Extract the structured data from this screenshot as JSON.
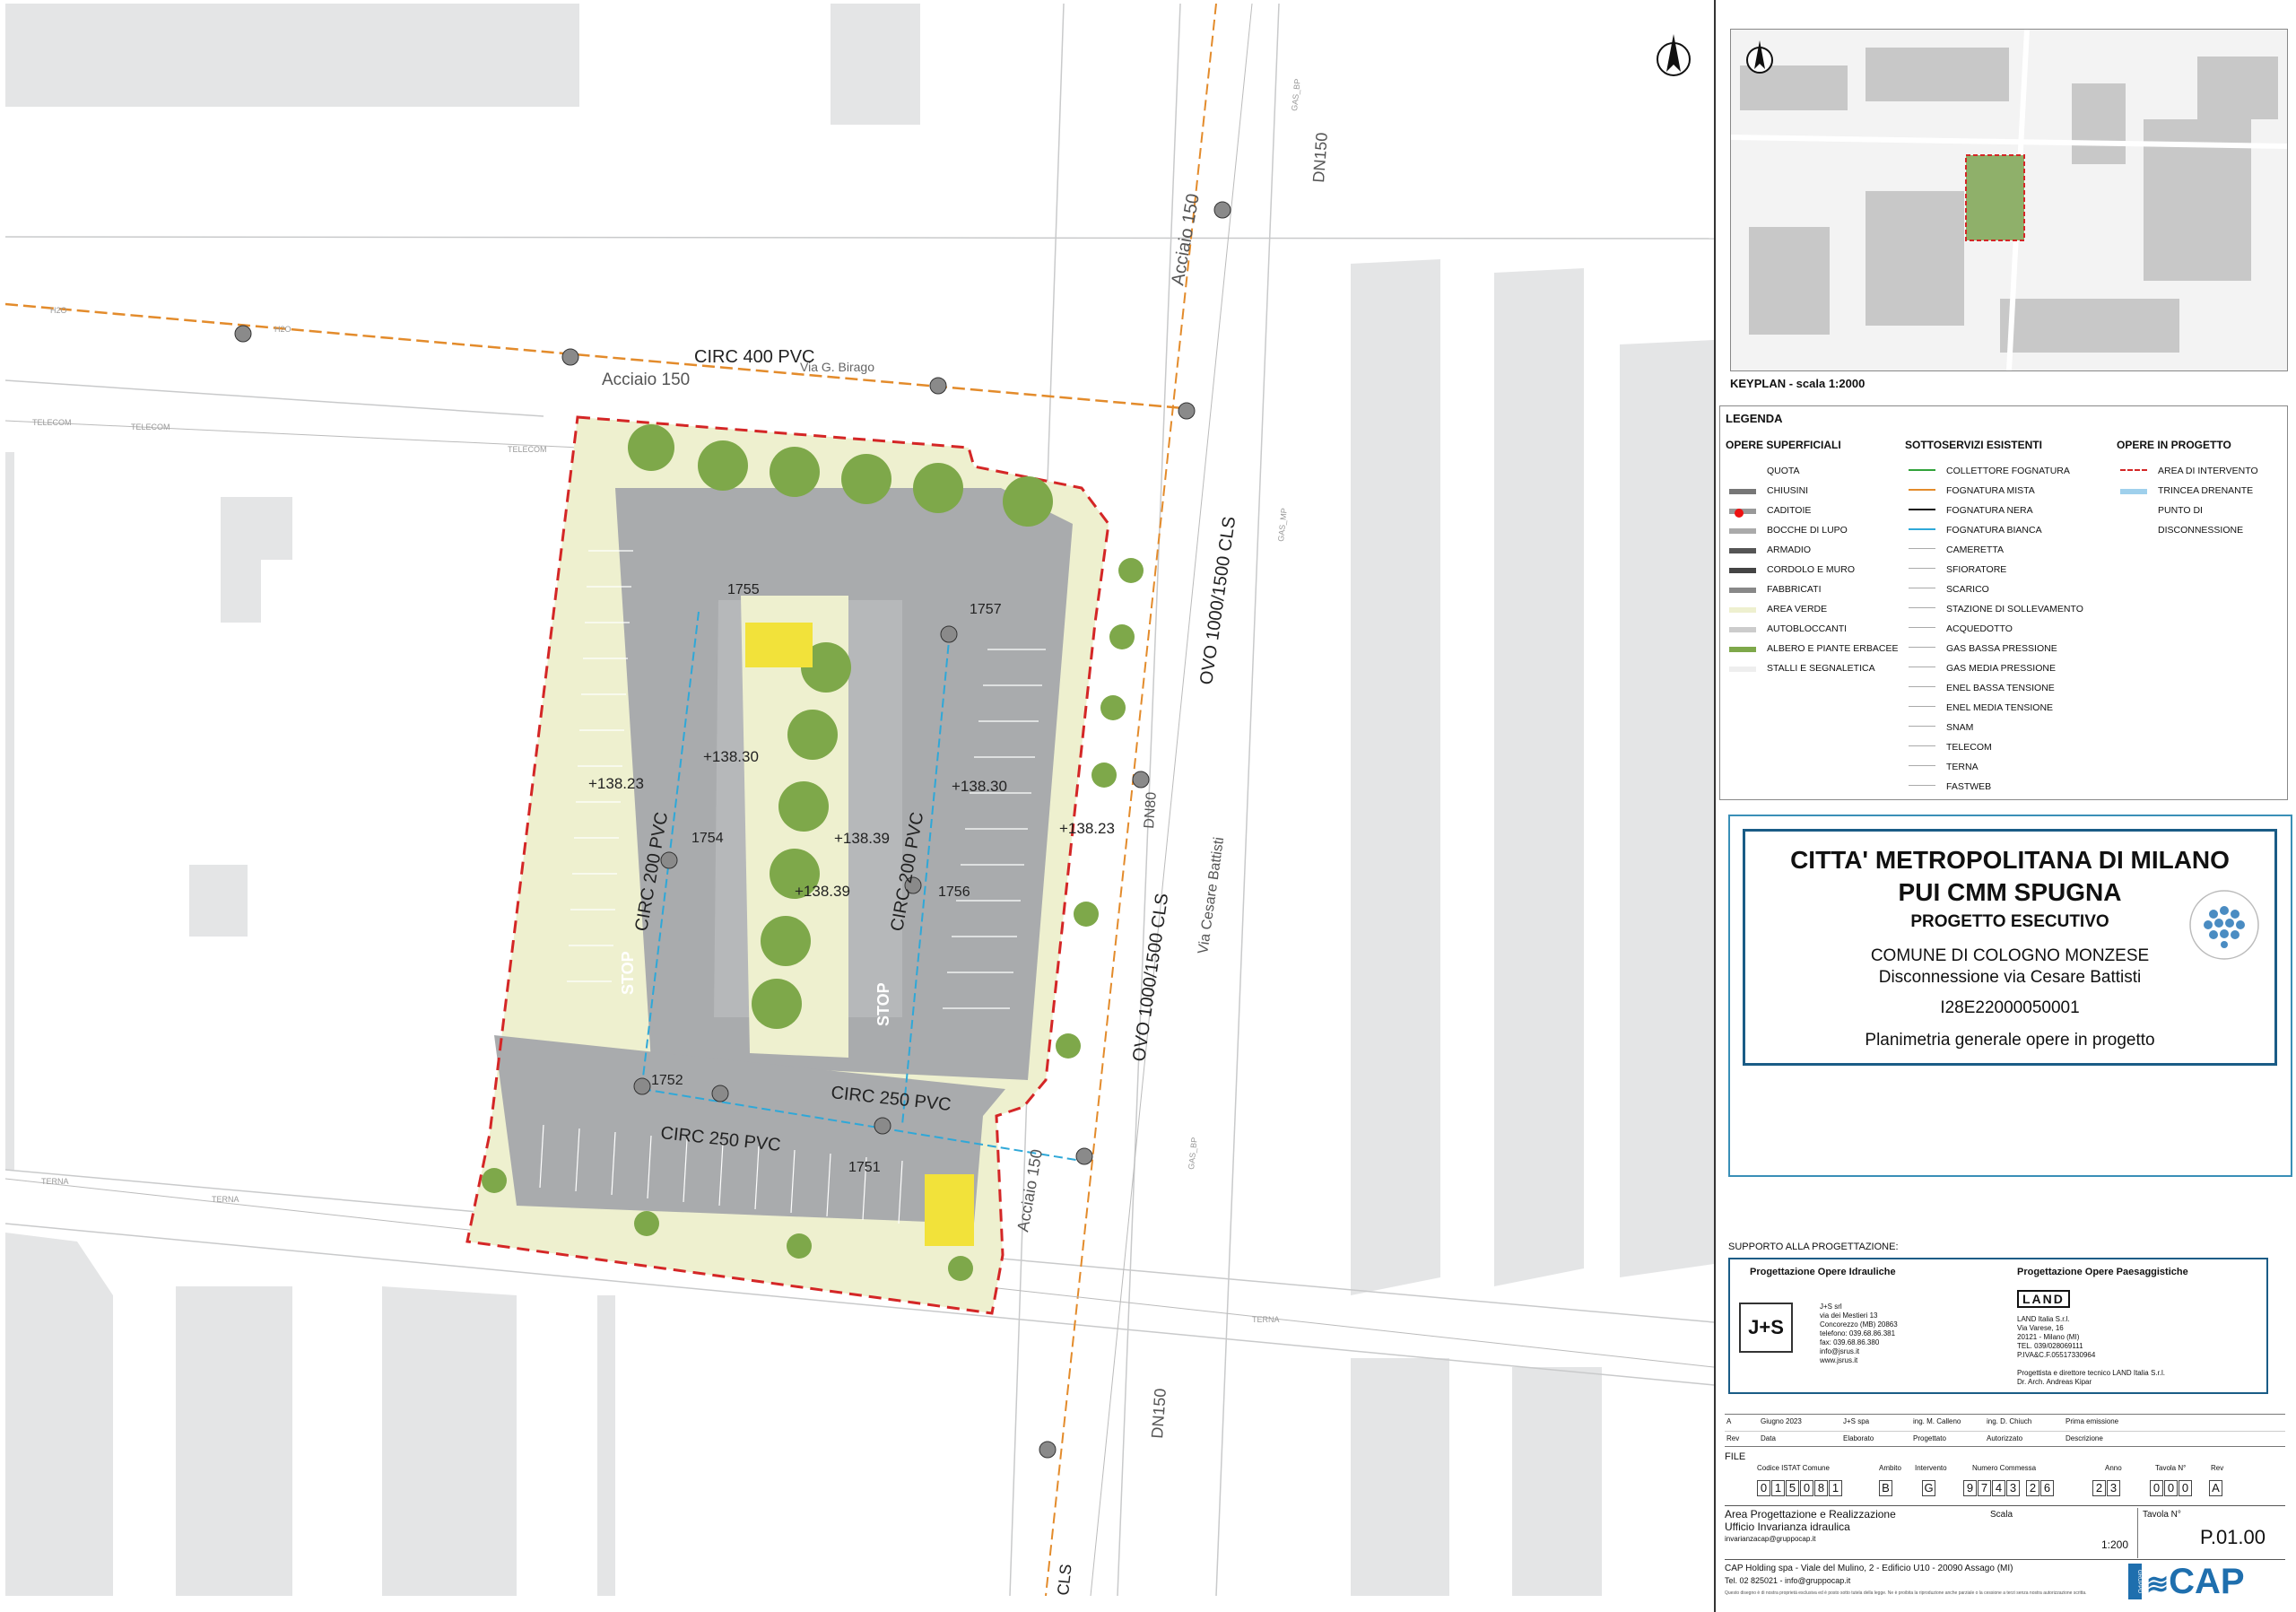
{
  "map": {
    "road_labels": {
      "circ400": "CIRC 400 PVC",
      "acciaio150_top": "Acciaio 150",
      "acciaio150_right": "Acciaio 150",
      "acciaio150_bottom": "Acciaio 150",
      "via_birago": "Via G. Birago",
      "via_battisti": "Via Cesare Battisti",
      "ovo_top": "OVO 1000/1500 CLS",
      "ovo_mid": "OVO 1000/1500 CLS",
      "cls_bottom": "CLS",
      "dn150_top": "DN150",
      "dn150_bottom": "DN150",
      "dn80": "DN80",
      "circ200_left": "CIRC 200 PVC",
      "circ200_right": "CIRC 200 PVC",
      "circ250_upper": "CIRC 250 PVC",
      "circ250_lower": "CIRC 250 PVC"
    },
    "network_labels": {
      "telecom": "TELECOM",
      "terna": "TERNA",
      "h2o": "H2O",
      "gas_mp": "GAS_MP",
      "gas_bp": "GAS_BP"
    },
    "manholes": {
      "m1755": "1755",
      "m1757": "1757",
      "m1754": "1754",
      "m1756": "1756",
      "m1752": "1752",
      "m1751": "1751"
    },
    "elevations": {
      "e1": "+138.23",
      "e2": "+138.30",
      "e3": "+138.30",
      "e4": "+138.39",
      "e5": "+138.39",
      "e6": "+138.23"
    },
    "stop": "STOP"
  },
  "keyplan": {
    "title": "KEYPLAN - scala 1:2000"
  },
  "legend": {
    "title": "LEGENDA",
    "col1_title": "OPERE SUPERFICIALI",
    "col2_title": "SOTTOSERVIZI ESISTENTI",
    "col3_title": "OPERE IN PROGETTO",
    "col1": [
      "QUOTA",
      "CHIUSINI",
      "CADITOIE",
      "BOCCHE DI LUPO",
      "ARMADIO",
      "CORDOLO E MURO",
      "FABBRICATI",
      "AREA VERDE",
      "AUTOBLOCCANTI",
      "ALBERO E PIANTE ERBACEE",
      "STALLI E SEGNALETICA"
    ],
    "col2": [
      "COLLETTORE FOGNATURA",
      "FOGNATURA MISTA",
      "FOGNATURA NERA",
      "FOGNATURA BIANCA",
      "CAMERETTA",
      "SFIORATORE",
      "SCARICO",
      "STAZIONE DI SOLLEVAMENTO",
      "ACQUEDOTTO",
      "GAS BASSA PRESSIONE",
      "GAS MEDIA PRESSIONE",
      "ENEL BASSA TENSIONE",
      "ENEL MEDIA TENSIONE",
      "SNAM",
      "TELECOM",
      "TERNA",
      "FASTWEB"
    ],
    "col3": [
      "AREA DI INTERVENTO",
      "TRINCEA DRENANTE",
      "PUNTO DI",
      "DISCONNESSIONE"
    ]
  },
  "title_block": {
    "line1": "CITTA' METROPOLITANA DI MILANO",
    "line2": "PUI CMM SPUGNA",
    "line3": "PROGETTO ESECUTIVO",
    "line4": "COMUNE DI COLOGNO MONZESE",
    "line5": "Disconnessione via Cesare Battisti",
    "line6": "I28E22000050001",
    "line7": "Planimetria generale opere in progetto"
  },
  "support": {
    "title": "SUPPORTO ALLA PROGETTAZIONE:",
    "hydraulic_title": "Progettazione Opere Idrauliche",
    "landscape_title": "Progettazione Opere Paesaggistiche",
    "js_logo": "J+S",
    "js_lines": [
      "J+S srl",
      "via dei Mestieri 13",
      "Concorezzo (MB) 20863",
      "telefono: 039.68.86.381",
      "fax: 039.68.86.380",
      "info@jsrus.it",
      "www.jsrus.it"
    ],
    "land_logo": "LAND",
    "land_lines": [
      "LAND Italia S.r.l.",
      "Via Varese, 16",
      "20121 - Milano (MI)",
      "TEL. 039/028069111",
      "P.IVA&C.F.05517330964"
    ],
    "land_credits": [
      "Progettista e direttore tecnico LAND Italia S.r.l.",
      "Dr. Arch. Andreas Kipar"
    ]
  },
  "revisions": {
    "row": [
      "A",
      "Giugno 2023",
      "J+S spa",
      "ing. M. Calleno",
      "ing. D. Chiuch",
      "Prima emissione"
    ],
    "headers": [
      "Rev",
      "Data",
      "Elaborato",
      "Progettato",
      "Autorizzato",
      "Descrizione"
    ]
  },
  "file_block": {
    "label": "FILE",
    "headers": [
      "Codice ISTAT Comune",
      "Ambito",
      "Intervento",
      "Numero Commessa",
      "Anno",
      "Tavola N°",
      "Rev"
    ],
    "istat": "015081",
    "ambito": "B",
    "intervento": "G",
    "commessa1": "9743",
    "commessa2": "26",
    "anno": "23",
    "tavola": "000",
    "rev": "A"
  },
  "area_block": {
    "line1": "Area Progettazione e Realizzazione",
    "line2": "Ufficio Invarianza idraulica",
    "email": "invarianzacap@gruppocap.it",
    "scale_label": "Scala",
    "scale_value": "1:200",
    "tavola_label": "Tavola N°",
    "tavola_value": "P.01.00"
  },
  "footer": {
    "company": "CAP Holding spa - Viale del Mulino, 2 - Edificio U10 - 20090 Assago (MI)",
    "contact": "Tel. 02 825021 - info@gruppocap.it",
    "disclaimer": "Questo disegno è di nostra proprietà esclusiva ed è posto sotto tutela della legge. Ne è proibita la riproduzione anche parziale o la cessione a terzi senza nostra autorizzazione scritta.",
    "logo": "CAP",
    "gruppo": "GRUPPO"
  },
  "colors": {
    "green_area": "#eef0cf",
    "paving": "#a9abad",
    "tree": "#7ea84a",
    "red_boundary": "#d42626",
    "blue_drain": "#2fa8d8",
    "gas_orange": "#e38b2b",
    "title_blue": "#1a5c86",
    "cap_blue": "#1f6fae"
  }
}
